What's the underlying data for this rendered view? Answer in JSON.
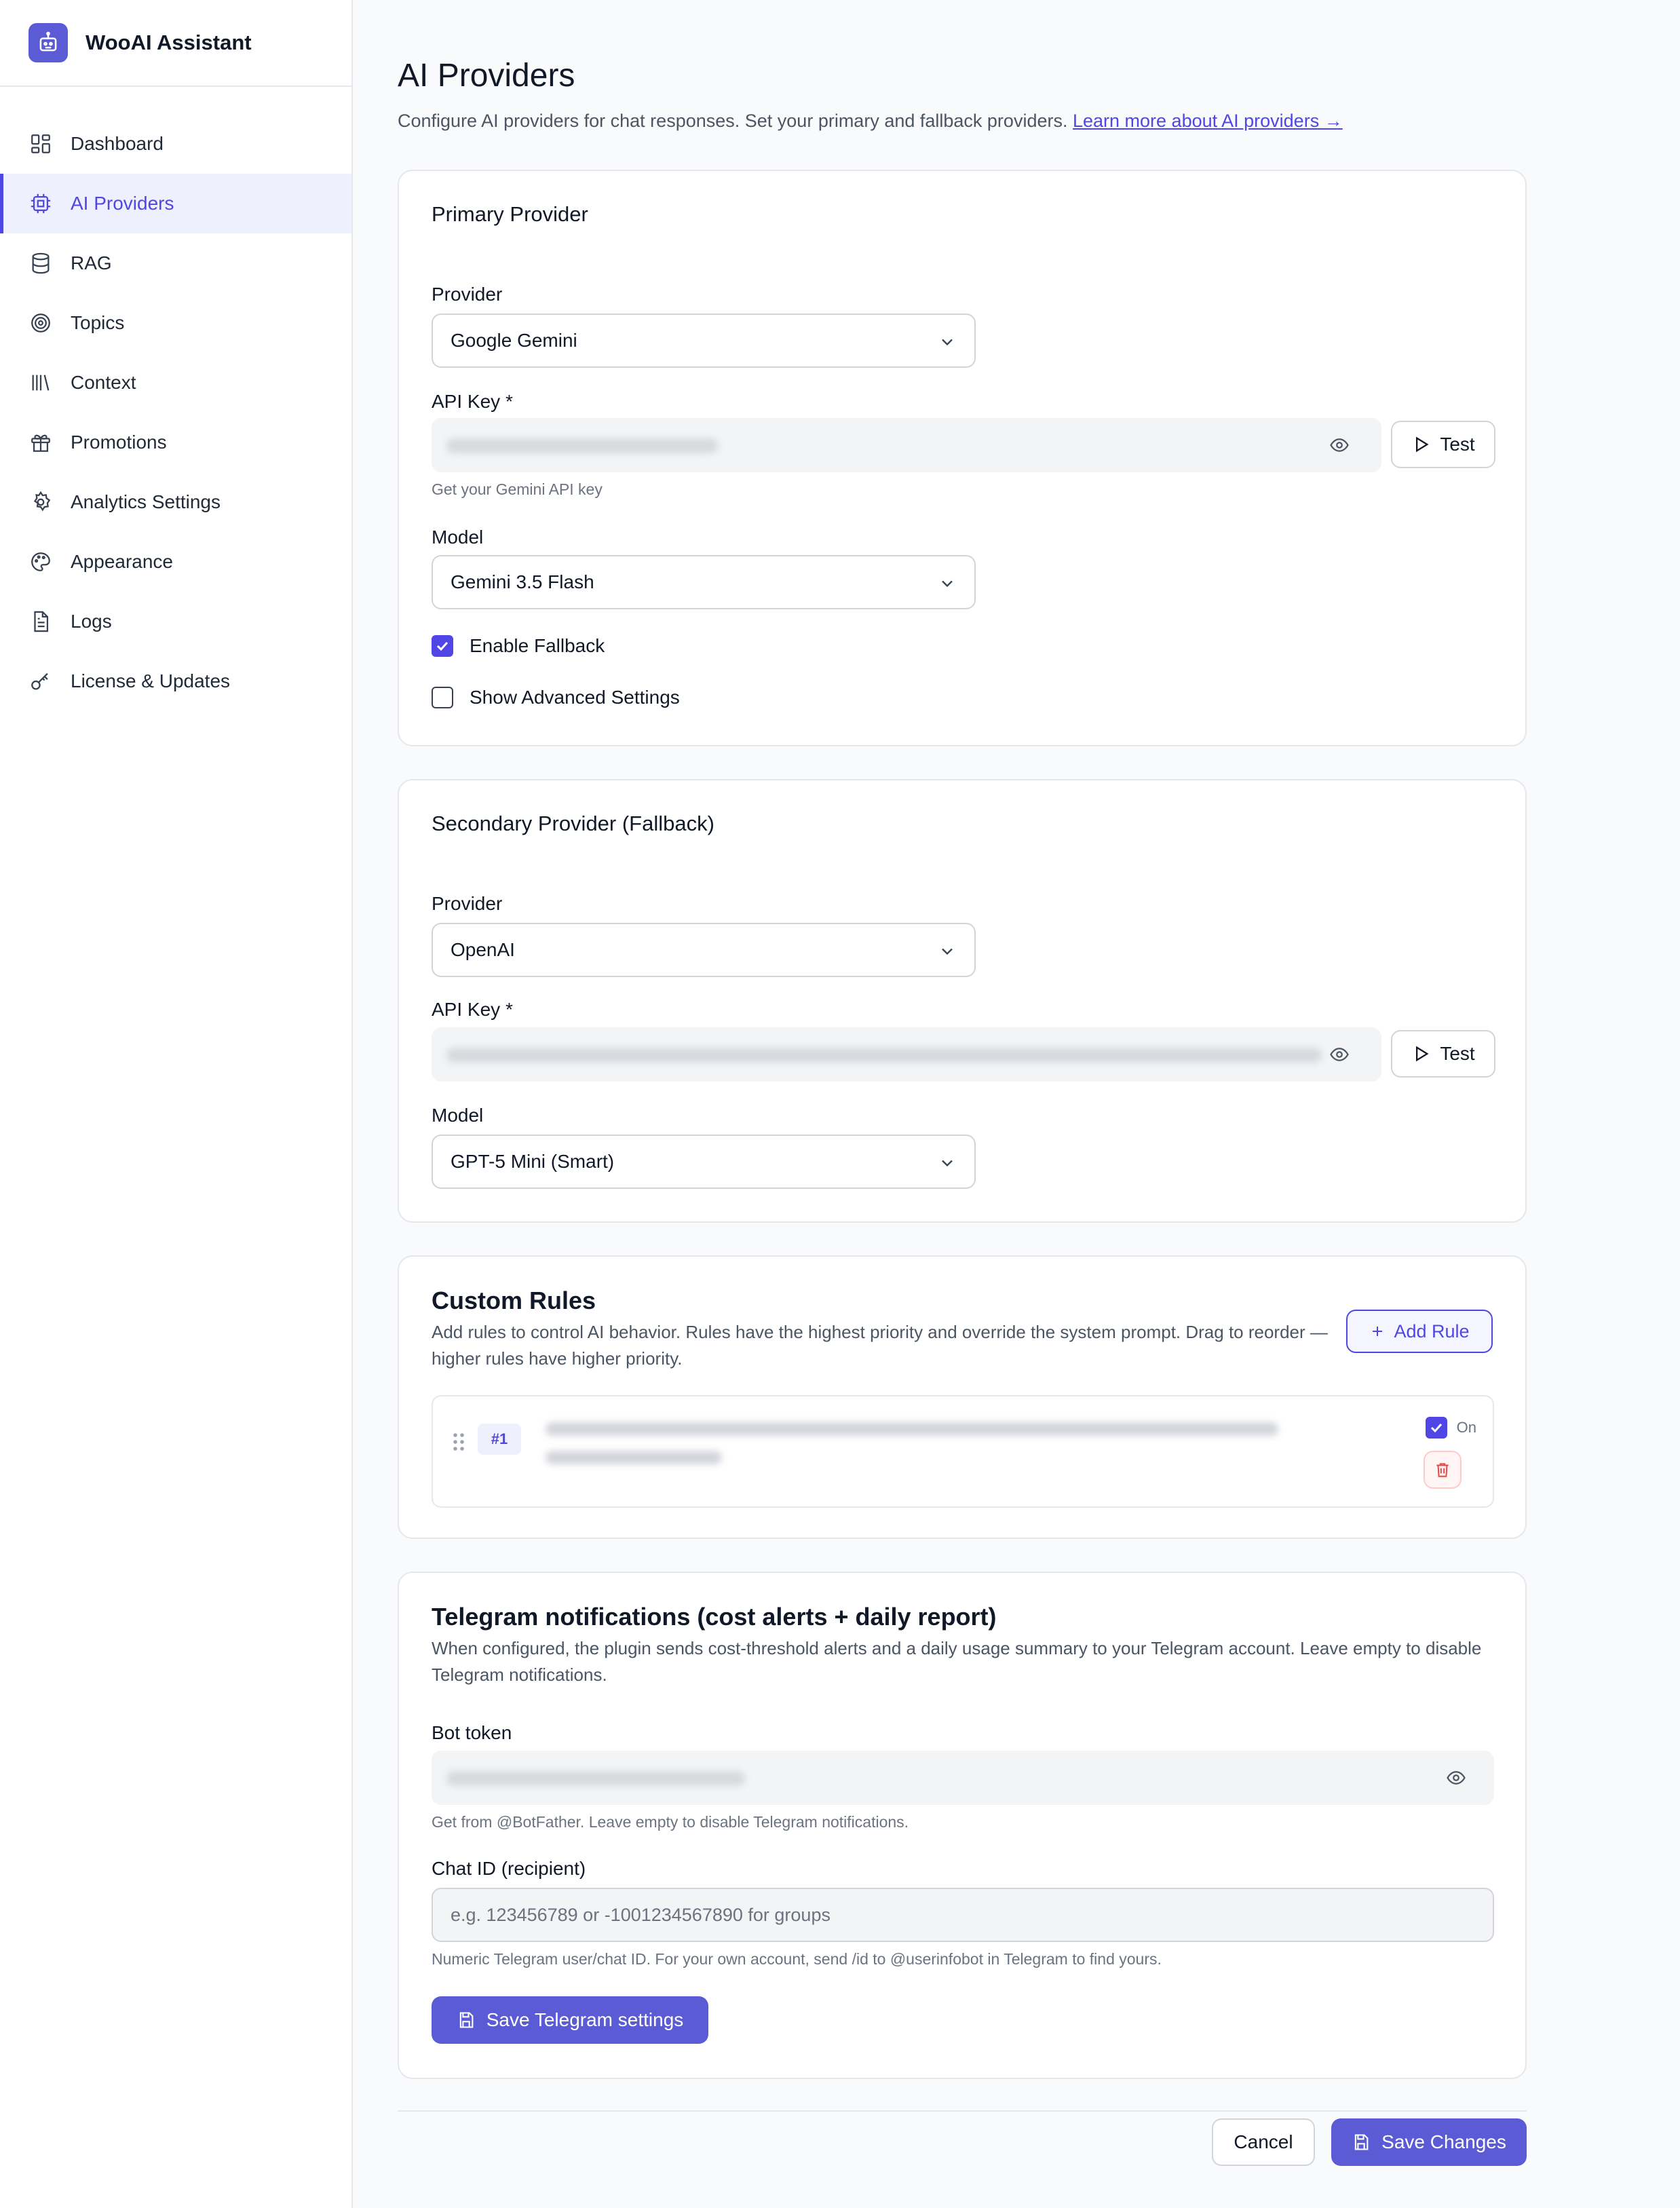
{
  "app": {
    "title": "WooAI Assistant"
  },
  "sidebar": {
    "items": [
      {
        "label": "Dashboard",
        "icon": "dashboard-icon"
      },
      {
        "label": "AI Providers",
        "icon": "cpu-icon",
        "active": true
      },
      {
        "label": "RAG",
        "icon": "database-icon"
      },
      {
        "label": "Topics",
        "icon": "target-icon"
      },
      {
        "label": "Context",
        "icon": "library-icon"
      },
      {
        "label": "Promotions",
        "icon": "gift-icon"
      },
      {
        "label": "Analytics Settings",
        "icon": "gear-icon"
      },
      {
        "label": "Appearance",
        "icon": "palette-icon"
      },
      {
        "label": "Logs",
        "icon": "document-icon"
      },
      {
        "label": "License & Updates",
        "icon": "key-icon"
      }
    ]
  },
  "page": {
    "title": "AI Providers",
    "description": "Configure AI providers for chat responses. Set your primary and fallback providers.",
    "learn_more": "Learn more about AI providers →"
  },
  "primary": {
    "title": "Primary Provider",
    "provider_label": "Provider",
    "provider_value": "Google Gemini",
    "api_key_label": "API Key *",
    "test_label": "Test",
    "api_key_hint": "Get your Gemini API key",
    "model_label": "Model",
    "model_value": "Gemini 3.5 Flash",
    "enable_fallback_label": "Enable Fallback",
    "enable_fallback_checked": true,
    "advanced_label": "Show Advanced Settings",
    "advanced_checked": false
  },
  "secondary": {
    "title": "Secondary Provider (Fallback)",
    "provider_label": "Provider",
    "provider_value": "OpenAI",
    "api_key_label": "API Key *",
    "test_label": "Test",
    "model_label": "Model",
    "model_value": "GPT-5 Mini (Smart)"
  },
  "rules": {
    "title": "Custom Rules",
    "description": "Add rules to control AI behavior. Rules have the highest priority and override the system prompt. Drag to reorder — higher rules have higher priority.",
    "add_label": "Add Rule",
    "items": [
      {
        "badge": "#1",
        "on_label": "On",
        "enabled": true
      }
    ]
  },
  "telegram": {
    "title": "Telegram notifications (cost alerts + daily report)",
    "description": "When configured, the plugin sends cost-threshold alerts and a daily usage summary to your Telegram account. Leave empty to disable Telegram notifications.",
    "bot_token_label": "Bot token",
    "bot_token_hint": "Get from @BotFather. Leave empty to disable Telegram notifications.",
    "chat_id_label": "Chat ID (recipient)",
    "chat_id_placeholder": "e.g. 123456789 or -1001234567890 for groups",
    "chat_id_hint": "Numeric Telegram user/chat ID. For your own account, send /id to @userinfobot in Telegram to find yours.",
    "save_label": "Save Telegram settings"
  },
  "footer": {
    "cancel_label": "Cancel",
    "save_label": "Save Changes"
  },
  "colors": {
    "accent": "#4f46e5",
    "button": "#5b5bd6",
    "danger": "#ef4444"
  }
}
